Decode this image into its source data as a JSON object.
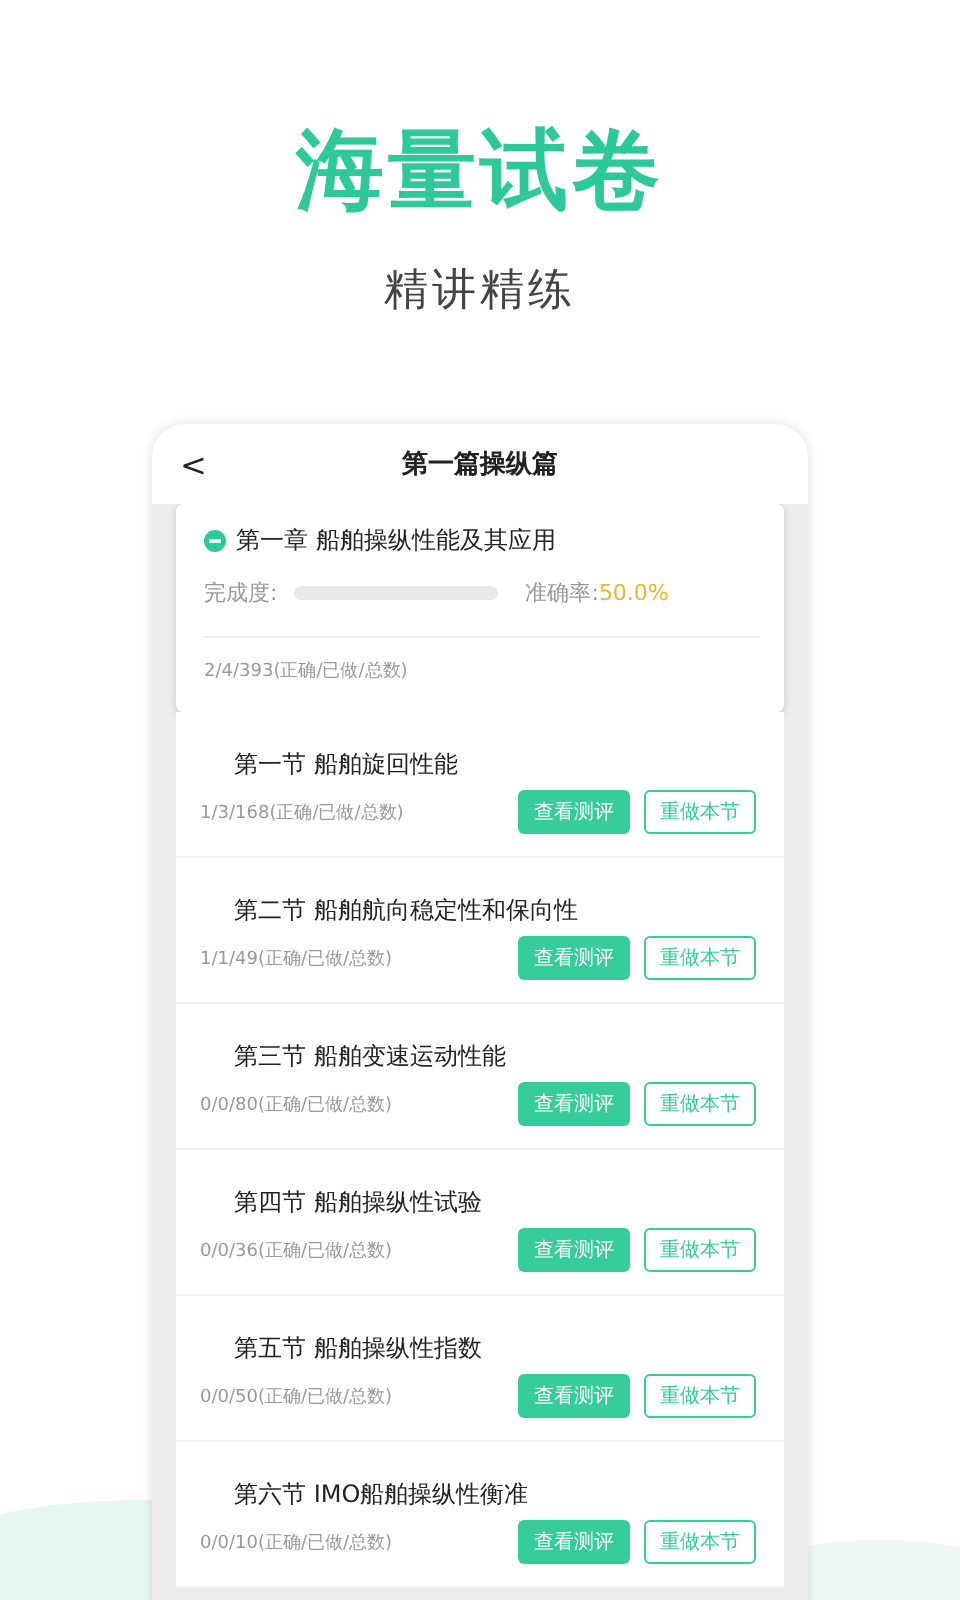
{
  "headline": "海量试卷",
  "subheadline": "精讲精练",
  "header": {
    "back": "<",
    "title": "第一篇操纵篇"
  },
  "chapter": {
    "title": "第一章 船舶操纵性能及其应用",
    "expanded": true,
    "progress_label": "完成度:",
    "level": 0,
    "accuracy_label": "准确率:",
    "accuracy": "50.0%",
    "counts": "2/4/393(正确/已做/总数)"
  },
  "sections": [
    {
      "title": "第一节 船舶旋回性能",
      "counts": "1/3/168(正确/已做/总数)",
      "review": "查看测评",
      "redo": "重做本节"
    },
    {
      "title": "第二节 船舶航向稳定性和保向性",
      "counts": "1/1/49(正确/已做/总数)",
      "review": "查看测评",
      "redo": "重做本节"
    },
    {
      "title": "第三节 船舶变速运动性能",
      "counts": "0/0/80(正确/已做/总数)",
      "review": "查看测评",
      "redo": "重做本节"
    },
    {
      "title": "第四节 船舶操纵性试验",
      "counts": "0/0/36(正确/已做/总数)",
      "review": "查看测评",
      "redo": "重做本节"
    },
    {
      "title": "第五节 船舶操纵性指数",
      "counts": "0/0/50(正确/已做/总数)",
      "review": "查看测评",
      "redo": "重做本节"
    },
    {
      "title": "第六节 IMO船舶操纵性衡准",
      "counts": "0/0/10(正确/已做/总数)",
      "review": "查看测评",
      "redo": "重做本节"
    }
  ]
}
